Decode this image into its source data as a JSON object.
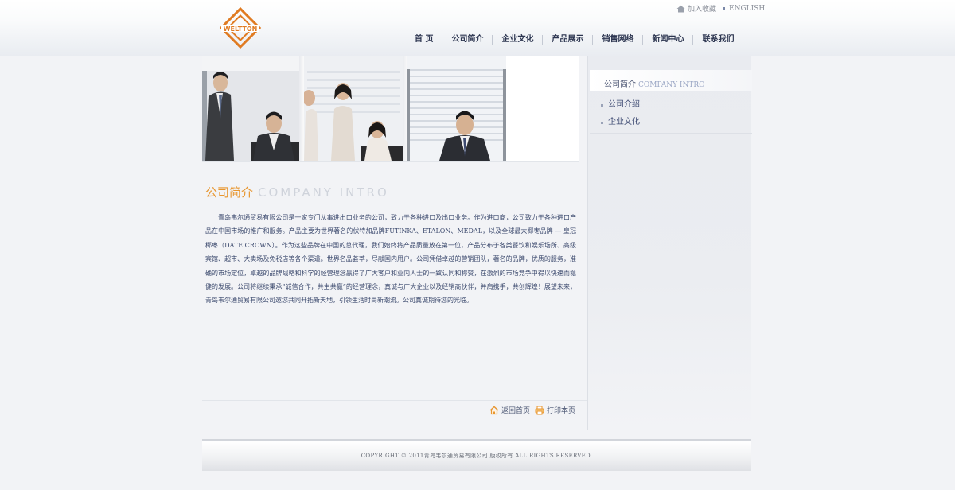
{
  "header": {
    "logo_text": "WELTTON",
    "top_links": [
      {
        "label": "加入收藏",
        "icon": "house-icon"
      },
      {
        "label": "ENGLISH"
      }
    ],
    "nav": [
      "首 页",
      "公司简介",
      "企业文化",
      "产品展示",
      "销售网络",
      "新闻中心",
      "联系我们"
    ]
  },
  "main": {
    "title_cn": "公司简介",
    "title_en": "COMPANY INTRO",
    "intro": "青岛韦尔通贸易有限公司是一家专门从事进出口业务的公司，致力于各种进口及出口业务。作为进口商，公司致力于各种进口产品在中国市场的推广和服务。产品主要为世界著名的伏特加品牌FUTINKA、ETALON、MEDAL，以及全球最大椰枣品牌 — 皇冠椰枣（DATE CROWN）。作为这些品牌在中国的总代理，我们始终将产品质量放在第一位，产品分布于各类餐饮和娱乐场所、高级宾馆、超市、大卖场及免税店等各个渠道。世界名品荟萃，尽献国内用户。公司凭借卓越的营销团队，著名的品牌，优质的服务，准确的市场定位，卓越的品牌战略和科学的经营理念赢得了广大客户和业内人士的一致认同和称赞，在激烈的市场竞争中得以快速而稳健的发展。公司将继续秉承“诚信合作，共生共赢”的经营理念，真诚与广大企业以及经销商伙伴，并肩携手，共创辉煌！展望未来，青岛韦尔通贸易有限公司邀您共同开拓新天地，引领生活时尚新潮流。公司真诚期待您的光临。"
  },
  "bottom_links": [
    {
      "label": "返回首页",
      "icon": "home-icon"
    },
    {
      "label": "打印本页",
      "icon": "printer-icon"
    }
  ],
  "sidebar": {
    "title_cn": "公司简介",
    "title_en": "COMPANY INTRO",
    "items": [
      "公司介绍",
      "企业文化"
    ]
  },
  "footer": {
    "copyright": "COPYRIGHT © 2011青岛韦尔通贸易有限公司 版权所有 ALL RIGHTS RESERVED."
  },
  "colors": {
    "accent": "#e8962f",
    "nav_text": "#2c3550",
    "body_text": "#3c4a6e"
  }
}
